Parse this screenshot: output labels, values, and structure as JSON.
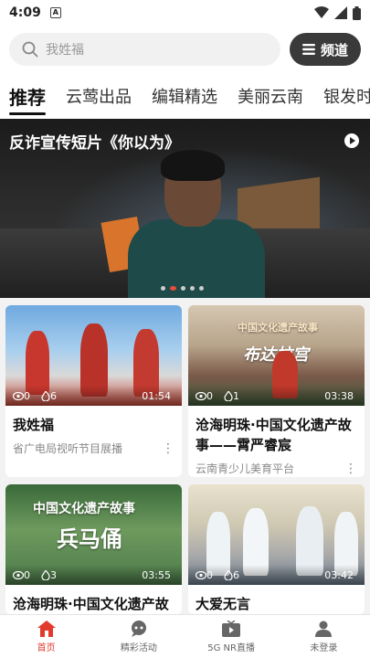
{
  "status_bar": {
    "time": "4:09",
    "notification_icon": "A"
  },
  "search": {
    "placeholder": "我姓福",
    "channel_label": "频道"
  },
  "tabs": [
    {
      "label": "推荐",
      "active": true
    },
    {
      "label": "云莺出品"
    },
    {
      "label": "编辑精选"
    },
    {
      "label": "美丽云南"
    },
    {
      "label": "银发时"
    }
  ],
  "banner": {
    "title": "反诈宣传短片《你以为》",
    "dot_count": 5,
    "active_dot": 1
  },
  "cards": [
    {
      "title": "我姓福",
      "source": "省广电局视听节目展播",
      "views": "0",
      "likes": "6",
      "duration": "01:54",
      "overlay_text": ""
    },
    {
      "title": "沧海明珠·中国文化遗产故事——霄严睿宸",
      "source": "云南青少儿美育平台",
      "views": "0",
      "likes": "1",
      "duration": "03:38",
      "overlay_text": "中国文化遗产故事",
      "overlay_sub": "布达拉宫"
    },
    {
      "title": "沧海明珠·中国文化遗产故",
      "source": "",
      "views": "0",
      "likes": "3",
      "duration": "03:55",
      "overlay_text": "中国文化遗产故事",
      "overlay_sub": "兵马俑"
    },
    {
      "title": "大爱无言",
      "source": "",
      "views": "0",
      "likes": "6",
      "duration": "03:42",
      "overlay_text": ""
    }
  ],
  "bottom_nav": [
    {
      "label": "首页",
      "icon": "home-icon",
      "active": true
    },
    {
      "label": "精彩活动",
      "icon": "chat-icon"
    },
    {
      "label": "5G NR直播",
      "icon": "tv-icon"
    },
    {
      "label": "未登录",
      "icon": "user-icon"
    }
  ],
  "colors": {
    "accent": "#e23b2e",
    "channel_button": "#3a3a3a"
  }
}
